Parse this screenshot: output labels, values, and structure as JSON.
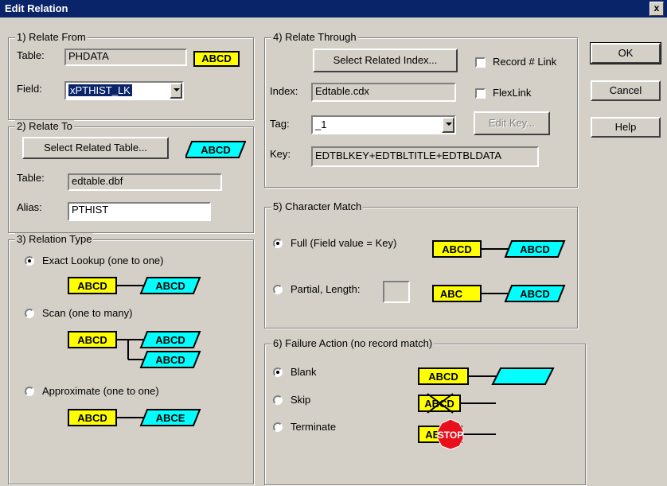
{
  "window": {
    "title": "Edit Relation",
    "close_label": "x"
  },
  "buttons": {
    "ok": "OK",
    "cancel": "Cancel",
    "help": "Help"
  },
  "relate_from": {
    "group_label": "1) Relate From",
    "table_label": "Table:",
    "table_value": "PHDATA",
    "field_label": "Field:",
    "field_value": "xPTHIST_LK",
    "badge": "ABCD"
  },
  "relate_to": {
    "group_label": "2) Relate To",
    "select_table_button": "Select Related Table...",
    "badge": "ABCD",
    "table_label": "Table:",
    "table_value": "edtable.dbf",
    "alias_label": "Alias:",
    "alias_value": "PTHIST"
  },
  "relation_type": {
    "group_label": "3) Relation Type",
    "options": [
      {
        "label": "Exact Lookup (one to one)",
        "selected": true
      },
      {
        "label": "Scan (one to many)",
        "selected": false
      },
      {
        "label": "Approximate (one to one)",
        "selected": false
      }
    ],
    "diagrams": {
      "exact": {
        "left": "ABCD",
        "right": "ABCD"
      },
      "scan": {
        "left": "ABCD",
        "right1": "ABCD",
        "right2": "ABCD"
      },
      "approx": {
        "left": "ABCD",
        "right": "ABCE"
      }
    }
  },
  "relate_through": {
    "group_label": "4) Relate Through",
    "select_index_button": "Select Related Index...",
    "record_link_label": "Record # Link",
    "record_link_checked": false,
    "index_label": "Index:",
    "index_value": "Edtable.cdx",
    "flexlink_label": "FlexLink",
    "flexlink_checked": false,
    "tag_label": "Tag:",
    "tag_value": "_1",
    "edit_key_button": "Edit Key...",
    "key_label": "Key:",
    "key_value": "EDTBLKEY+EDTBLTITLE+EDTBLDATA"
  },
  "character_match": {
    "group_label": "5) Character Match",
    "full_label": "Full (Field value = Key)",
    "full_selected": true,
    "partial_label": "Partial, Length:",
    "partial_selected": false,
    "partial_length": "",
    "diagrams": {
      "full": {
        "left": "ABCD",
        "right": "ABCD"
      },
      "partial": {
        "left": "ABC",
        "right": "ABCD"
      }
    }
  },
  "failure_action": {
    "group_label": "6) Failure Action (no record match)",
    "options": [
      {
        "label": "Blank",
        "selected": true
      },
      {
        "label": "Skip",
        "selected": false
      },
      {
        "label": "Terminate",
        "selected": false
      }
    ],
    "diagrams": {
      "blank": "ABCD",
      "skip": "ABCD",
      "terminate": "ABCD",
      "stop_text": "STOP"
    }
  },
  "colors": {
    "titlebar": "#0a246a",
    "badge_yellow": "#ffff00",
    "badge_cyan": "#00ffff",
    "stop_red": "#e8101a",
    "face": "#d4d0c8"
  }
}
